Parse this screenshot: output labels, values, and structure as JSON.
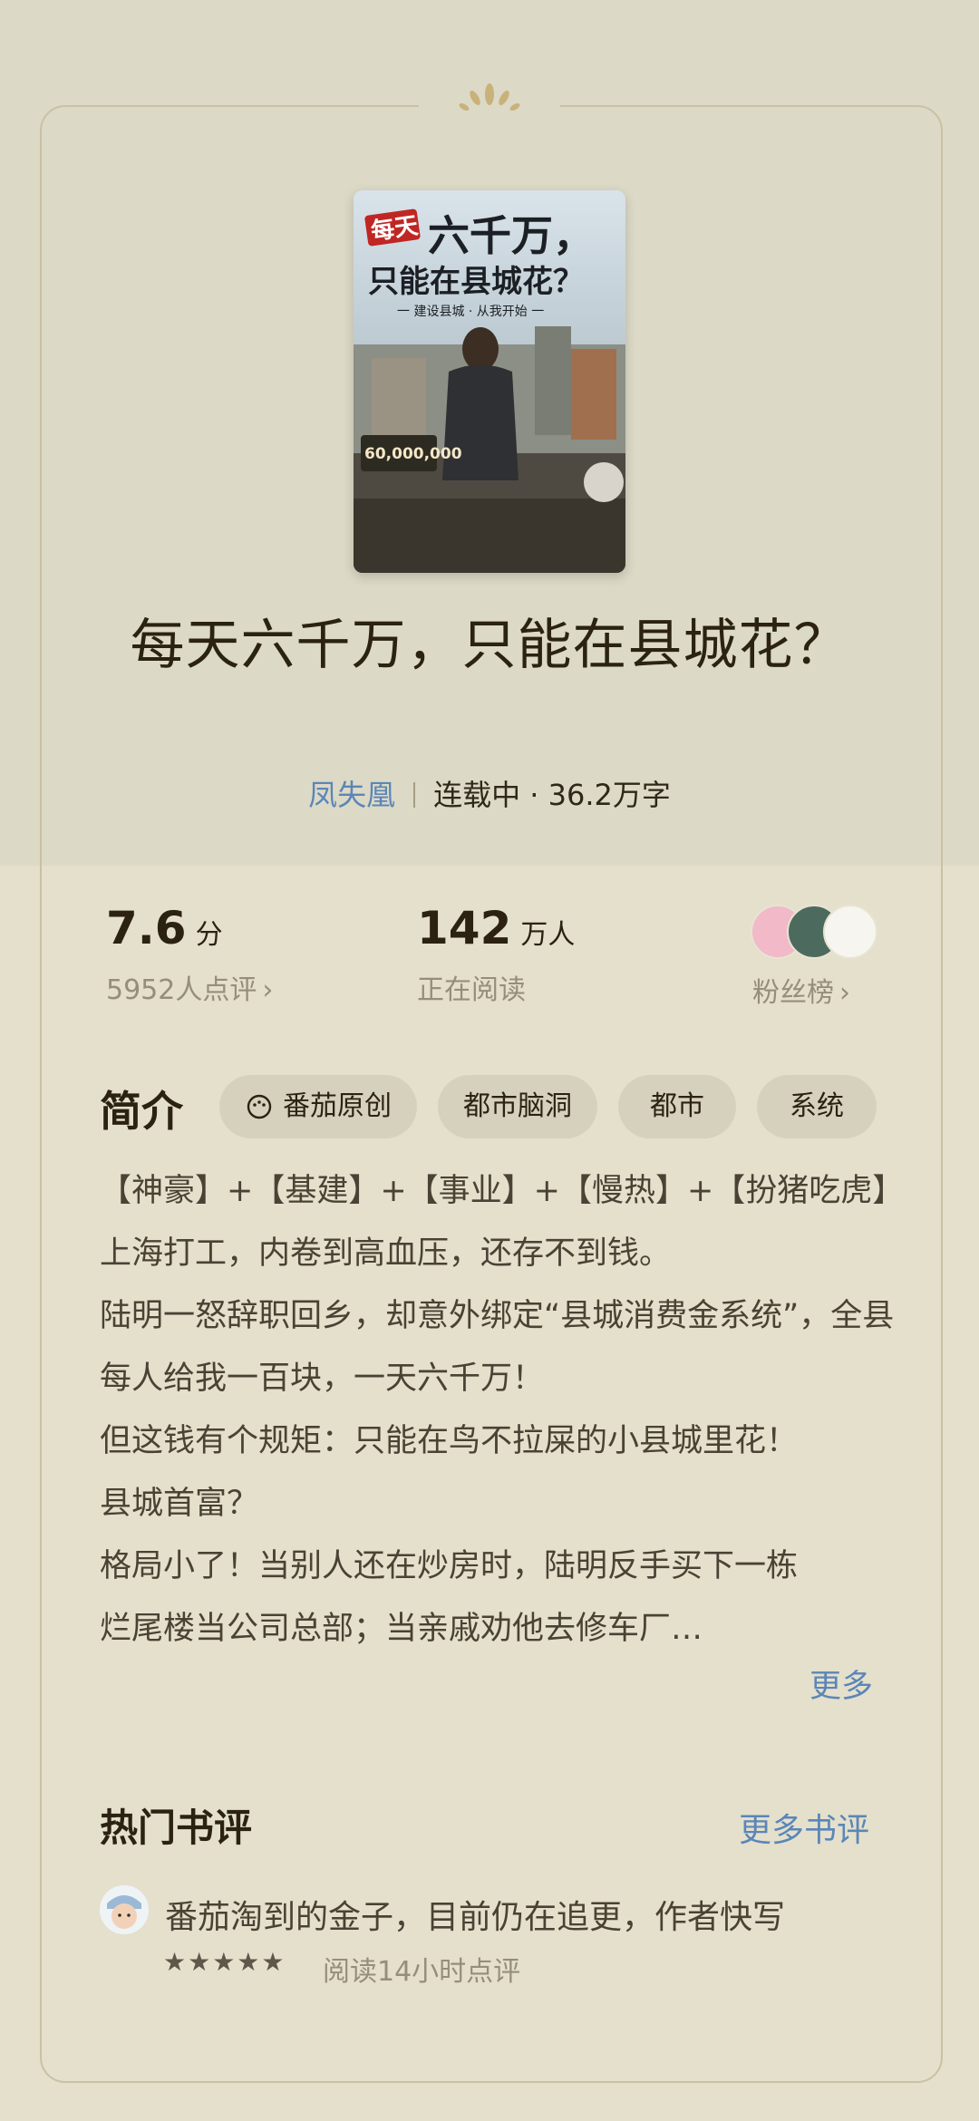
{
  "book": {
    "title": "每天六千万，只能在县城花？",
    "author": "凤失凰",
    "status_words": "连载中 · 36.2万字"
  },
  "cover": {
    "badge": "每天",
    "title_line1": "六千万，",
    "title_line2": "只能在县城花？",
    "slogan": "一 建设县城 · 从我开始 一",
    "amount": "60,000,000",
    "side_tag": "番茄原创"
  },
  "stats": {
    "score": "7.6",
    "score_unit": "分",
    "score_sub": "5952人点评",
    "readers": "142",
    "readers_unit": "万人",
    "readers_sub": "正在阅读",
    "fans_label": "粉丝榜"
  },
  "intro": {
    "heading": "简介",
    "tags": [
      "番茄原创",
      "都市脑洞",
      "都市",
      "系统"
    ],
    "paragraphs": [
      "【神豪】+【基建】+【事业】+【慢热】+【扮猪吃虎】",
      "上海打工，内卷到高血压，还存不到钱。",
      "陆明一怒辞职回乡，却意外绑定“县城消费金系统”，全县每人给我一百块，一天六千万！",
      "但这钱有个规矩：只能在鸟不拉屎的小县城里花！",
      "县城首富？",
      "格局小了！当别人还在炒房时，陆明反手买下一栋烂尾楼当公司总部；当亲戚劝他去修车厂…"
    ],
    "more": "更多"
  },
  "reviews": {
    "heading": "热门书评",
    "more": "更多书评",
    "items": [
      {
        "text": "番茄淘到的金子，目前仍在追更，作者快写",
        "stars": "★★★★★",
        "meta": "阅读14小时点评"
      }
    ]
  },
  "colors": {
    "background": "#e4e0cc",
    "top_band": "#dcd9c6",
    "link": "#5b86b8",
    "title": "#2b2212",
    "muted": "#968e7a"
  }
}
